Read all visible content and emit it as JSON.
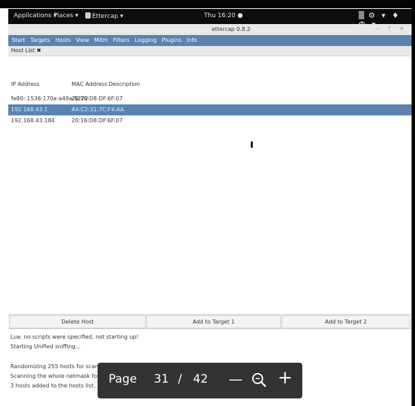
{
  "topbar": {
    "applications": "Applications ▾",
    "places": "Places ▾",
    "ettercap_menu": "Ettercap ▾",
    "clock": "Thu 16:20 ●",
    "tray": "⚙ ▾ ♦ Ф ▾"
  },
  "window": {
    "title": "ettercap 0.8.2",
    "controls": "– ? ×"
  },
  "menu": {
    "items": [
      "Start",
      "Targets",
      "Hosts",
      "View",
      "Mitm",
      "Filters",
      "Logging",
      "Plugins",
      "Info"
    ]
  },
  "tabs": {
    "host_list": "Host List ✖"
  },
  "host_table": {
    "headers": [
      "IP Address",
      "MAC Address",
      "Description"
    ],
    "rows": [
      {
        "ip": "fe80::1536:170e:a49a:5272",
        "mac": "20:16:D8:DF:6F:07"
      },
      {
        "ip": "192.168.43.1",
        "mac": "A4:C2:31:7C:F4:AA"
      },
      {
        "ip": "192.168.43.184",
        "mac": "20:16:D8:DF:6F:07"
      }
    ]
  },
  "buttons": {
    "delete_host": "Delete Host",
    "add_target_1": "Add to Target 1",
    "add_target_2": "Add to Target 2"
  },
  "log": [
    "Lua: no scripts were specified, not starting up!",
    "Starting Unified sniffing...",
    "",
    "Randomizing 255 hosts for scanning...",
    "Scanning the whole netmask for 255 hosts...",
    "3 hosts added to the hosts list..."
  ],
  "pager": {
    "label": "Page",
    "current": "31",
    "separator": "/",
    "total": "42",
    "minus_glyph": "—",
    "plus_glyph": "+"
  }
}
